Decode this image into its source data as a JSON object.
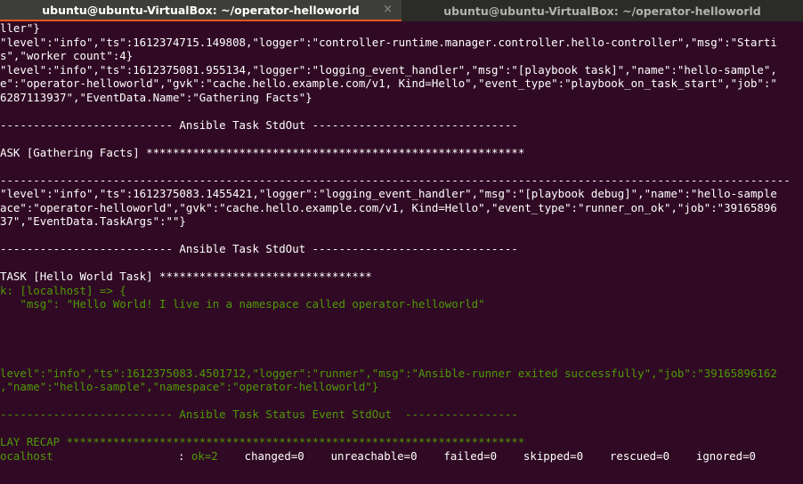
{
  "tabs": [
    {
      "title": "ubuntu@ubuntu-VirtualBox: ~/operator-helloworld",
      "close": "×"
    },
    {
      "title": "ubuntu@ubuntu-VirtualBox: ~/operator-helloworld"
    }
  ],
  "lines": [
    {
      "text": "ller\"}",
      "color": "w"
    },
    {
      "text": "\"level\":\"info\",\"ts\":1612374715.149808,\"logger\":\"controller-runtime.manager.controller.hello-controller\",\"msg\":\"Starti",
      "color": "w"
    },
    {
      "text": "s\",\"worker count\":4}",
      "color": "w"
    },
    {
      "text": "\"level\":\"info\",\"ts\":1612375081.955134,\"logger\":\"logging_event_handler\",\"msg\":\"[playbook task]\",\"name\":\"hello-sample\",",
      "color": "w"
    },
    {
      "text": "e\":\"operator-helloworld\",\"gvk\":\"cache.hello.example.com/v1, Kind=Hello\",\"event_type\":\"playbook_on_task_start\",\"job\":\"",
      "color": "w"
    },
    {
      "text": "6287113937\",\"EventData.Name\":\"Gathering Facts\"}",
      "color": "w"
    },
    {
      "text": "",
      "color": "w"
    },
    {
      "text": "-------------------------- Ansible Task StdOut -------------------------------",
      "color": "w"
    },
    {
      "text": "",
      "color": "w"
    },
    {
      "text": "ASK [Gathering Facts] *********************************************************",
      "color": "w"
    },
    {
      "text": "",
      "color": "w"
    },
    {
      "text": "-----------------------------------------------------------------------------------------------------------------------",
      "color": "w"
    },
    {
      "text": "\"level\":\"info\",\"ts\":1612375083.1455421,\"logger\":\"logging_event_handler\",\"msg\":\"[playbook debug]\",\"name\":\"hello-sample",
      "color": "w"
    },
    {
      "text": "ace\":\"operator-helloworld\",\"gvk\":\"cache.hello.example.com/v1, Kind=Hello\",\"event_type\":\"runner_on_ok\",\"job\":\"39165896",
      "color": "w"
    },
    {
      "text": "37\",\"EventData.TaskArgs\":\"\"}",
      "color": "w"
    },
    {
      "text": "",
      "color": "w"
    },
    {
      "text": "-------------------------- Ansible Task StdOut -------------------------------",
      "color": "w"
    },
    {
      "text": "",
      "color": "w"
    },
    {
      "text": "TASK [Hello World Task] ********************************",
      "color": "w"
    },
    {
      "text": "k: [localhost] => {",
      "color": "g"
    },
    {
      "text": "   \"msg\": \"Hello World! I live in a namespace called operator-helloworld\"",
      "color": "g"
    },
    {
      "text": "",
      "color": "w"
    },
    {
      "text": "",
      "color": "w"
    },
    {
      "text": "",
      "color": "w"
    },
    {
      "text": "",
      "color": "w"
    },
    {
      "text": "level\":\"info\",\"ts\":1612375083.4501712,\"logger\":\"runner\",\"msg\":\"Ansible-runner exited successfully\",\"job\":\"39165896162",
      "color": "g"
    },
    {
      "text": ",\"name\":\"hello-sample\",\"namespace\":\"operator-helloworld\"}",
      "color": "g"
    },
    {
      "text": "",
      "color": "w"
    },
    {
      "text": "-------------------------- Ansible Task Status Event StdOut  -----------------",
      "color": "g"
    },
    {
      "text": "",
      "color": "w"
    },
    {
      "text": "LAY RECAP *********************************************************************",
      "color": "g"
    }
  ],
  "recap": {
    "host": "ocalhost",
    "colon": ": ",
    "ok": "ok=2",
    "rest": "    changed=0    unreachable=0    failed=0    skipped=0    rescued=0    ignored=0"
  }
}
